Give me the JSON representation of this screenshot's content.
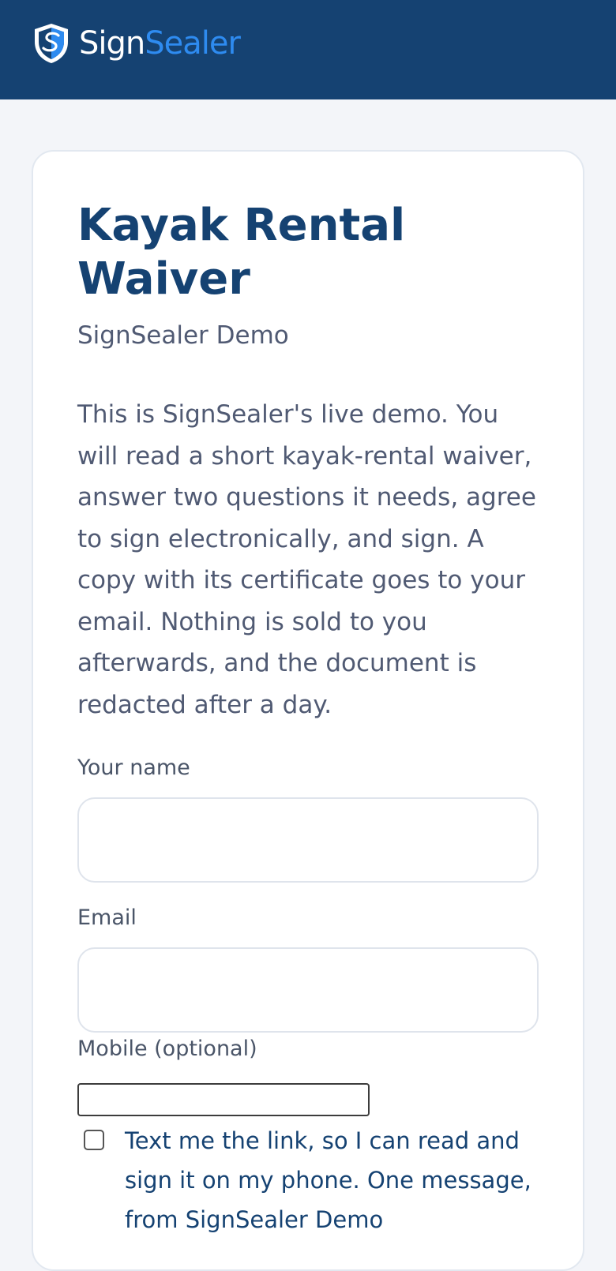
{
  "header": {
    "brand_part1": "Sign",
    "brand_part2": "Sealer",
    "logo_icon": "shield-icon",
    "colors": {
      "bar": "#154272",
      "brand_accent": "#2e8bf0"
    }
  },
  "document": {
    "title": "Kayak Rental Waiver",
    "subtitle": "SignSealer Demo",
    "intro": "This is SignSealer's live demo. You will read a short kayak-rental waiver, answer two questions it needs, agree to sign electronically, and sign. A copy with its certificate goes to your email. Nothing is sold to you afterwards, and the document is redacted after a day."
  },
  "form": {
    "name_label": "Your name",
    "name_value": "",
    "email_label": "Email",
    "email_value": "",
    "mobile_label": "Mobile (optional)",
    "mobile_value": "",
    "sms_checkbox_checked": false,
    "sms_checkbox_label": "Text me the link, so I can read and sign it on my phone. One message, from SignSealer Demo"
  }
}
